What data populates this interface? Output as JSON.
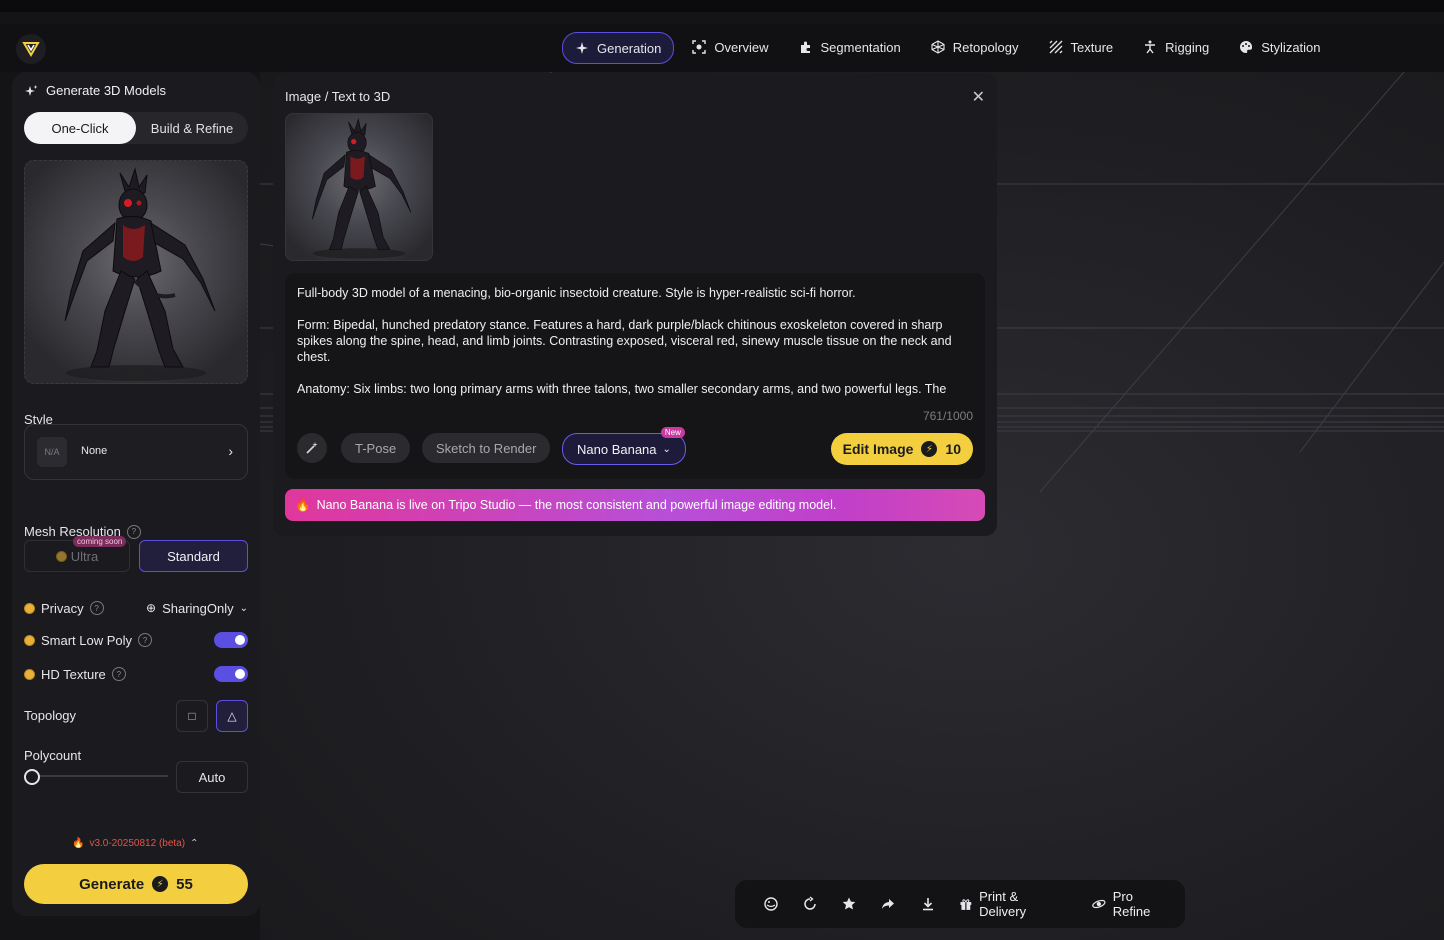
{
  "nav": {
    "items": [
      {
        "label": "Generation",
        "icon": "sparkle-icon",
        "active": true
      },
      {
        "label": "Overview",
        "icon": "scan-icon",
        "active": false
      },
      {
        "label": "Segmentation",
        "icon": "puzzle-icon",
        "active": false
      },
      {
        "label": "Retopology",
        "icon": "mesh-icon",
        "active": false
      },
      {
        "label": "Texture",
        "icon": "texture-icon",
        "active": false
      },
      {
        "label": "Rigging",
        "icon": "figure-icon",
        "active": false
      },
      {
        "label": "Stylization",
        "icon": "palette-icon",
        "active": false
      }
    ]
  },
  "left_panel": {
    "title": "Generate 3D Models",
    "mode_tabs": [
      "One-Click",
      "Build & Refine"
    ],
    "style_label": "Style",
    "style_placeholder": "N/A",
    "style_value": "None",
    "mesh_resolution_label": "Mesh Resolution",
    "ultra_label": "Ultra",
    "coming_soon": "coming soon",
    "standard_label": "Standard",
    "privacy_label": "Privacy",
    "privacy_value": "SharingOnly",
    "smart_low_poly_label": "Smart Low Poly",
    "hd_texture_label": "HD Texture",
    "topology_label": "Topology",
    "polycount_label": "Polycount",
    "polycount_value": "Auto",
    "version": "v3.0-20250812 (beta)",
    "generate_label": "Generate",
    "generate_cost": "55"
  },
  "dialog": {
    "title": "Image / Text to 3D",
    "prompt": "Full-body 3D model of a menacing, bio-organic insectoid creature. Style is hyper-realistic sci-fi horror.\n\nForm: Bipedal, hunched predatory stance. Features a hard, dark purple/black chitinous exoskeleton covered in sharp spikes along the spine, head, and limb joints. Contrasting exposed, visceral red, sinewy muscle tissue on the neck and chest.\n\nAnatomy: Six limbs: two long primary arms with three talons, two smaller secondary arms, and two powerful legs. The",
    "counter": "761/1000",
    "tpose_label": "T-Pose",
    "sketch_label": "Sketch to Render",
    "nano_label": "Nano Banana",
    "new_badge": "New",
    "edit_label": "Edit Image",
    "edit_cost": "10",
    "banner_emoji": "🔥",
    "banner_text": "Nano Banana is live on Tripo Studio — the most consistent and powerful image editing model."
  },
  "bottom_toolbar": {
    "print_label": "Print & Delivery",
    "pro_refine_label": "Pro Refine"
  },
  "colors": {
    "accent": "#5a4fe0",
    "yellow": "#f3cf3f",
    "banner_start": "#e0379c",
    "banner_end": "#c13fc9"
  }
}
